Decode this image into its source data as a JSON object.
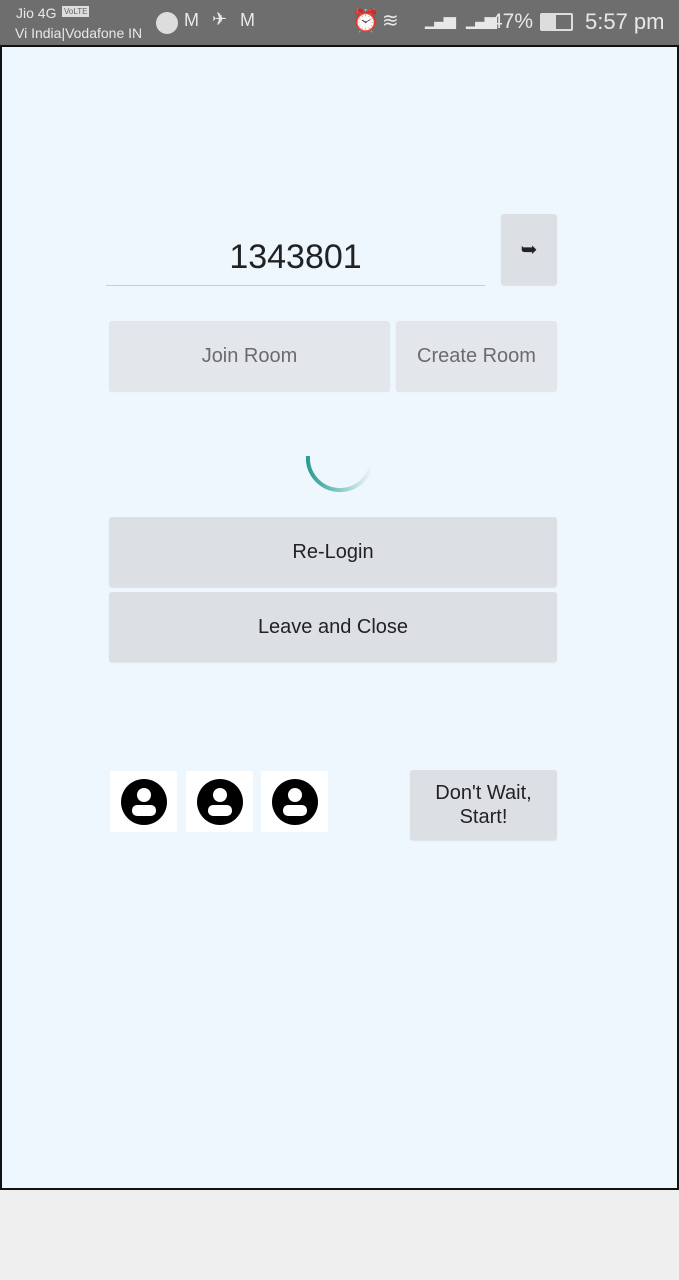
{
  "status_bar": {
    "carrier1": "Jio 4G",
    "volte": "VoLTE",
    "carrier2": "Vi India|Vodafone IN",
    "battery": "47%",
    "time": "5:57 pm",
    "icons": [
      "message-icon",
      "gmail-icon",
      "pin-icon",
      "gmail-icon",
      "alarm-icon",
      "wifi-icon",
      "signal-icon",
      "signal-icon",
      "battery-icon"
    ]
  },
  "room": {
    "code_value": "1343801",
    "go_icon": "arrow-right-icon",
    "join_label": "Join Room",
    "create_label": "Create Room"
  },
  "loading": {
    "spinner_color": "#2a9d8f"
  },
  "actions": {
    "relogin_label": "Re-Login",
    "leave_label": "Leave and Close"
  },
  "lobby": {
    "players": [
      "user-avatar",
      "user-avatar",
      "user-avatar"
    ],
    "start_label_line1": "Don't Wait,",
    "start_label_line2": "Start!"
  }
}
